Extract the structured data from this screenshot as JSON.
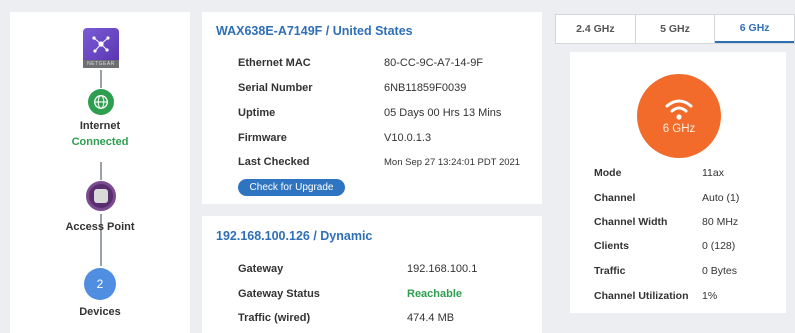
{
  "topology": {
    "router_brand": "NETGEAR",
    "internet": {
      "label": "Internet",
      "status": "Connected"
    },
    "access_point": {
      "label": "Access Point"
    },
    "devices": {
      "label": "Devices",
      "count": "2"
    }
  },
  "device_card": {
    "title": "WAX638E-A7149F / United States",
    "rows": [
      {
        "label": "Ethernet MAC",
        "value": "80-CC-9C-A7-14-9F"
      },
      {
        "label": "Serial Number",
        "value": "6NB11859F0039"
      },
      {
        "label": "Uptime",
        "value": "05 Days 00 Hrs 13 Mins"
      },
      {
        "label": "Firmware",
        "value": "V10.0.1.3"
      },
      {
        "label": "Last Checked",
        "value": "Mon Sep 27 13:24:01 PDT 2021"
      }
    ],
    "upgrade_button": "Check for Upgrade"
  },
  "network_card": {
    "title": "192.168.100.126 / Dynamic",
    "rows": [
      {
        "label": "Gateway",
        "value": "192.168.100.1"
      },
      {
        "label": "Gateway Status",
        "value": "Reachable"
      },
      {
        "label": "Traffic (wired)",
        "value": "474.4 MB"
      }
    ]
  },
  "radio_tabs": [
    "2.4 GHz",
    "5 GHz",
    "6 GHz"
  ],
  "active_tab": "6 GHz",
  "radio": {
    "band": "6 GHz",
    "rows": [
      {
        "label": "Mode",
        "value": "11ax"
      },
      {
        "label": "Channel",
        "value": "Auto (1)"
      },
      {
        "label": "Channel Width",
        "value": "80 MHz"
      },
      {
        "label": "Clients",
        "value": "0 (128)"
      },
      {
        "label": "Traffic",
        "value": "0 Bytes"
      },
      {
        "label": "Channel Utilization",
        "value": "1%"
      }
    ]
  },
  "colors": {
    "accent": "#2f6fb6",
    "connected": "#2e9e4f",
    "radio": "#f26b2a",
    "devices": "#4f8ee0",
    "access_point": "#5a2d6e"
  }
}
